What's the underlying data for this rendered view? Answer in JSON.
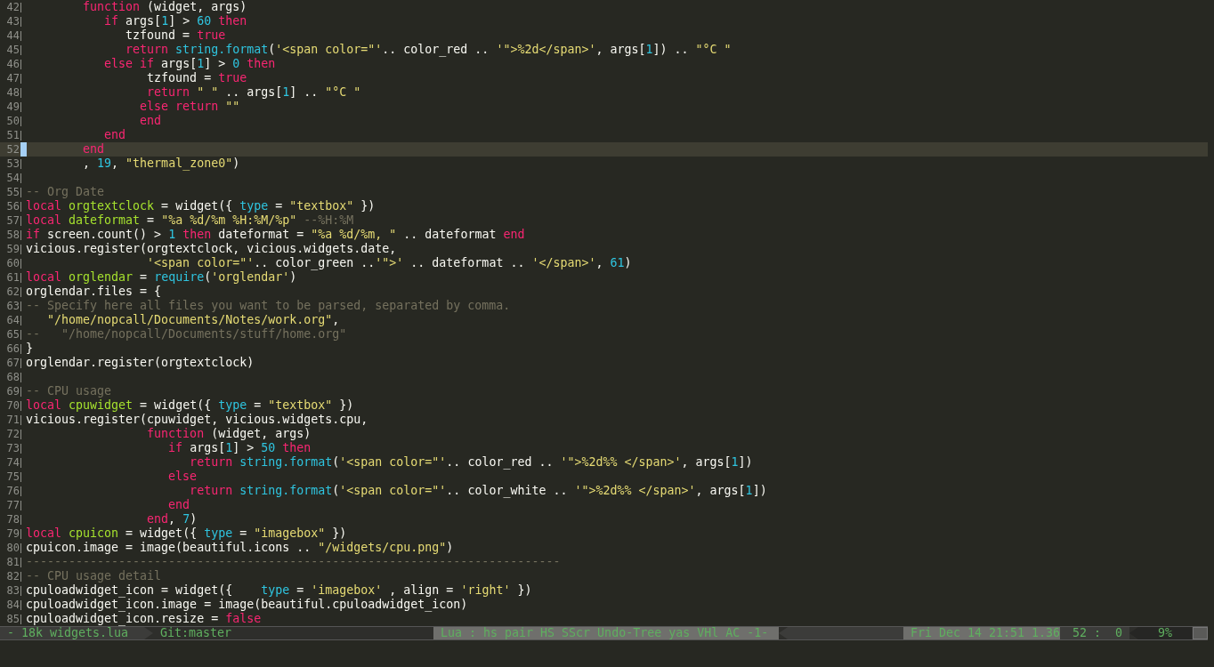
{
  "editor": {
    "lines": [
      {
        "number": "42",
        "current": false,
        "tokens": [
          {
            "kind": "kw",
            "text": "        function"
          },
          {
            "kind": "p",
            "text": " (widget, args)"
          }
        ]
      },
      {
        "number": "43",
        "current": false,
        "tokens": [
          {
            "kind": "kw",
            "text": "           if"
          },
          {
            "kind": "p",
            "text": " args["
          },
          {
            "kind": "num",
            "text": "1"
          },
          {
            "kind": "p",
            "text": "] > "
          },
          {
            "kind": "num",
            "text": "60"
          },
          {
            "kind": "kw",
            "text": " then"
          }
        ]
      },
      {
        "number": "44",
        "current": false,
        "tokens": [
          {
            "kind": "p",
            "text": "              tzfound = "
          },
          {
            "kind": "kw",
            "text": "true"
          }
        ]
      },
      {
        "number": "45",
        "current": false,
        "tokens": [
          {
            "kind": "kw",
            "text": "              return"
          },
          {
            "kind": "bi",
            "text": " string.format"
          },
          {
            "kind": "p",
            "text": "("
          },
          {
            "kind": "str",
            "text": "'<span color=\"'"
          },
          {
            "kind": "p",
            "text": ".. color_red .. "
          },
          {
            "kind": "str",
            "text": "'\">%2d</span>'"
          },
          {
            "kind": "p",
            "text": ", args["
          },
          {
            "kind": "num",
            "text": "1"
          },
          {
            "kind": "p",
            "text": "]) .. "
          },
          {
            "kind": "str",
            "text": "\"°C \""
          }
        ]
      },
      {
        "number": "46",
        "current": false,
        "tokens": [
          {
            "kind": "kw",
            "text": "           else if"
          },
          {
            "kind": "p",
            "text": " args["
          },
          {
            "kind": "num",
            "text": "1"
          },
          {
            "kind": "p",
            "text": "] > "
          },
          {
            "kind": "num",
            "text": "0"
          },
          {
            "kind": "kw",
            "text": " then"
          }
        ]
      },
      {
        "number": "47",
        "current": false,
        "tokens": [
          {
            "kind": "p",
            "text": "                 tzfound = "
          },
          {
            "kind": "kw",
            "text": "true"
          }
        ]
      },
      {
        "number": "48",
        "current": false,
        "tokens": [
          {
            "kind": "kw",
            "text": "                 return"
          },
          {
            "kind": "str",
            "text": " \" \""
          },
          {
            "kind": "p",
            "text": " .. args["
          },
          {
            "kind": "num",
            "text": "1"
          },
          {
            "kind": "p",
            "text": "] .. "
          },
          {
            "kind": "str",
            "text": "\"°C \""
          }
        ]
      },
      {
        "number": "49",
        "current": false,
        "tokens": [
          {
            "kind": "kw",
            "text": "                else return"
          },
          {
            "kind": "str",
            "text": " \"\""
          }
        ]
      },
      {
        "number": "50",
        "current": false,
        "tokens": [
          {
            "kind": "kw",
            "text": "                end"
          }
        ]
      },
      {
        "number": "51",
        "current": false,
        "tokens": [
          {
            "kind": "kw",
            "text": "           end"
          }
        ]
      },
      {
        "number": "52",
        "current": true,
        "tokens": [
          {
            "kind": "kw",
            "text": "        end"
          }
        ]
      },
      {
        "number": "53",
        "current": false,
        "tokens": [
          {
            "kind": "p",
            "text": "        , "
          },
          {
            "kind": "num",
            "text": "19"
          },
          {
            "kind": "p",
            "text": ", "
          },
          {
            "kind": "str",
            "text": "\"thermal_zone0\""
          },
          {
            "kind": "p",
            "text": ")"
          }
        ]
      },
      {
        "number": "54",
        "current": false
      },
      {
        "number": "55",
        "current": false,
        "tokens": [
          {
            "kind": "com",
            "text": "-- Org Date"
          }
        ]
      },
      {
        "number": "56",
        "current": false,
        "tokens": [
          {
            "kind": "kw",
            "text": "local"
          },
          {
            "kind": "var",
            "text": " orgtextclock"
          },
          {
            "kind": "p",
            "text": " = widget({ "
          },
          {
            "kind": "bi",
            "text": "type"
          },
          {
            "kind": "p",
            "text": " = "
          },
          {
            "kind": "str",
            "text": "\"textbox\""
          },
          {
            "kind": "p",
            "text": " })"
          }
        ]
      },
      {
        "number": "57",
        "current": false,
        "tokens": [
          {
            "kind": "kw",
            "text": "local"
          },
          {
            "kind": "var",
            "text": " dateformat"
          },
          {
            "kind": "p",
            "text": " = "
          },
          {
            "kind": "str",
            "text": "\"%a %d/%m %H:%M/%p\""
          },
          {
            "kind": "com",
            "text": " --%H:%M"
          }
        ]
      },
      {
        "number": "58",
        "current": false,
        "tokens": [
          {
            "kind": "kw",
            "text": "if"
          },
          {
            "kind": "p",
            "text": " screen.count() > "
          },
          {
            "kind": "num",
            "text": "1"
          },
          {
            "kind": "kw",
            "text": " then"
          },
          {
            "kind": "p",
            "text": " dateformat = "
          },
          {
            "kind": "str",
            "text": "\"%a %d/%m, \""
          },
          {
            "kind": "p",
            "text": " .. dateformat "
          },
          {
            "kind": "kw",
            "text": "end"
          }
        ]
      },
      {
        "number": "59",
        "current": false,
        "tokens": [
          {
            "kind": "p",
            "text": "vicious.register(orgtextclock, vicious.widgets.date,"
          }
        ]
      },
      {
        "number": "60",
        "current": false,
        "tokens": [
          {
            "kind": "str",
            "text": "                 '<span color=\"'"
          },
          {
            "kind": "p",
            "text": ".. color_green .."
          },
          {
            "kind": "str",
            "text": "'\">'"
          },
          {
            "kind": "p",
            "text": " .. dateformat .. "
          },
          {
            "kind": "str",
            "text": "'</span>'"
          },
          {
            "kind": "p",
            "text": ", "
          },
          {
            "kind": "num",
            "text": "61"
          },
          {
            "kind": "p",
            "text": ")"
          }
        ]
      },
      {
        "number": "61",
        "current": false,
        "tokens": [
          {
            "kind": "kw",
            "text": "local"
          },
          {
            "kind": "var",
            "text": " orglendar"
          },
          {
            "kind": "p",
            "text": " = "
          },
          {
            "kind": "bi",
            "text": "require"
          },
          {
            "kind": "p",
            "text": "("
          },
          {
            "kind": "str",
            "text": "'orglendar'"
          },
          {
            "kind": "p",
            "text": ")"
          }
        ]
      },
      {
        "number": "62",
        "current": false,
        "tokens": [
          {
            "kind": "p",
            "text": "orglendar.files = {"
          }
        ]
      },
      {
        "number": "63",
        "current": false,
        "tokens": [
          {
            "kind": "com",
            "text": "-- Specify here all files you want to be parsed, separated by comma."
          }
        ]
      },
      {
        "number": "64",
        "current": false,
        "tokens": [
          {
            "kind": "str",
            "text": "   \"/home/nopcall/Documents/Notes/work.org\""
          },
          {
            "kind": "p",
            "text": ","
          }
        ]
      },
      {
        "number": "65",
        "current": false,
        "tokens": [
          {
            "kind": "com",
            "text": "--   \"/home/nopcall/Documents/stuff/home.org\""
          }
        ]
      },
      {
        "number": "66",
        "current": false,
        "tokens": [
          {
            "kind": "p",
            "text": "}"
          }
        ]
      },
      {
        "number": "67",
        "current": false,
        "tokens": [
          {
            "kind": "p",
            "text": "orglendar.register(orgtextclock)"
          }
        ]
      },
      {
        "number": "68",
        "current": false
      },
      {
        "number": "69",
        "current": false,
        "tokens": [
          {
            "kind": "com",
            "text": "-- CPU usage"
          }
        ]
      },
      {
        "number": "70",
        "current": false,
        "tokens": [
          {
            "kind": "kw",
            "text": "local"
          },
          {
            "kind": "var",
            "text": " cpuwidget"
          },
          {
            "kind": "p",
            "text": " = widget({ "
          },
          {
            "kind": "bi",
            "text": "type"
          },
          {
            "kind": "p",
            "text": " = "
          },
          {
            "kind": "str",
            "text": "\"textbox\""
          },
          {
            "kind": "p",
            "text": " })"
          }
        ]
      },
      {
        "number": "71",
        "current": false,
        "tokens": [
          {
            "kind": "p",
            "text": "vicious.register(cpuwidget, vicious.widgets.cpu,"
          }
        ]
      },
      {
        "number": "72",
        "current": false,
        "tokens": [
          {
            "kind": "kw",
            "text": "                 function"
          },
          {
            "kind": "p",
            "text": " (widget, args)"
          }
        ]
      },
      {
        "number": "73",
        "current": false,
        "tokens": [
          {
            "kind": "kw",
            "text": "                    if"
          },
          {
            "kind": "p",
            "text": " args["
          },
          {
            "kind": "num",
            "text": "1"
          },
          {
            "kind": "p",
            "text": "] > "
          },
          {
            "kind": "num",
            "text": "50"
          },
          {
            "kind": "kw",
            "text": " then"
          }
        ]
      },
      {
        "number": "74",
        "current": false,
        "tokens": [
          {
            "kind": "kw",
            "text": "                       return"
          },
          {
            "kind": "bi",
            "text": " string.format"
          },
          {
            "kind": "p",
            "text": "("
          },
          {
            "kind": "str",
            "text": "'<span color=\"'"
          },
          {
            "kind": "p",
            "text": ".. color_red .. "
          },
          {
            "kind": "str",
            "text": "'\">%2d%% </span>'"
          },
          {
            "kind": "p",
            "text": ", args["
          },
          {
            "kind": "num",
            "text": "1"
          },
          {
            "kind": "p",
            "text": "])"
          }
        ]
      },
      {
        "number": "75",
        "current": false,
        "tokens": [
          {
            "kind": "kw",
            "text": "                    else"
          }
        ]
      },
      {
        "number": "76",
        "current": false,
        "tokens": [
          {
            "kind": "kw",
            "text": "                       return"
          },
          {
            "kind": "bi",
            "text": " string.format"
          },
          {
            "kind": "p",
            "text": "("
          },
          {
            "kind": "str",
            "text": "'<span color=\"'"
          },
          {
            "kind": "p",
            "text": ".. color_white .. "
          },
          {
            "kind": "str",
            "text": "'\">%2d%% </span>'"
          },
          {
            "kind": "p",
            "text": ", args["
          },
          {
            "kind": "num",
            "text": "1"
          },
          {
            "kind": "p",
            "text": "])"
          }
        ]
      },
      {
        "number": "77",
        "current": false,
        "tokens": [
          {
            "kind": "kw",
            "text": "                    end"
          }
        ]
      },
      {
        "number": "78",
        "current": false,
        "tokens": [
          {
            "kind": "kw",
            "text": "                 end"
          },
          {
            "kind": "p",
            "text": ", "
          },
          {
            "kind": "num",
            "text": "7"
          },
          {
            "kind": "p",
            "text": ")"
          }
        ]
      },
      {
        "number": "79",
        "current": false,
        "tokens": [
          {
            "kind": "kw",
            "text": "local"
          },
          {
            "kind": "var",
            "text": " cpuicon"
          },
          {
            "kind": "p",
            "text": " = widget({ "
          },
          {
            "kind": "bi",
            "text": "type"
          },
          {
            "kind": "p",
            "text": " = "
          },
          {
            "kind": "str",
            "text": "\"imagebox\""
          },
          {
            "kind": "p",
            "text": " })"
          }
        ]
      },
      {
        "number": "80",
        "current": false,
        "tokens": [
          {
            "kind": "p",
            "text": "cpuicon.image = image(beautiful.icons .. "
          },
          {
            "kind": "str",
            "text": "\"/widgets/cpu.png\""
          },
          {
            "kind": "p",
            "text": ")"
          }
        ]
      },
      {
        "number": "81",
        "current": false,
        "tokens": [
          {
            "kind": "com",
            "text": "---------------------------------------------------------------------------"
          }
        ]
      },
      {
        "number": "82",
        "current": false,
        "tokens": [
          {
            "kind": "com",
            "text": "-- CPU usage detail"
          }
        ]
      },
      {
        "number": "83",
        "current": false,
        "tokens": [
          {
            "kind": "p",
            "text": "cpuloadwidget_icon = widget({    "
          },
          {
            "kind": "bi",
            "text": "type"
          },
          {
            "kind": "p",
            "text": " = "
          },
          {
            "kind": "str",
            "text": "'imagebox'"
          },
          {
            "kind": "p",
            "text": " , align = "
          },
          {
            "kind": "str",
            "text": "'right'"
          },
          {
            "kind": "p",
            "text": " })"
          }
        ]
      },
      {
        "number": "84",
        "current": false,
        "tokens": [
          {
            "kind": "p",
            "text": "cpuloadwidget_icon.image = image(beautiful.cpuloadwidget_icon)"
          }
        ]
      },
      {
        "number": "85",
        "current": false,
        "tokens": [
          {
            "kind": "p",
            "text": "cpuloadwidget_icon.resize = "
          },
          {
            "kind": "kw",
            "text": "false"
          }
        ]
      }
    ]
  },
  "mode_line": {
    "buffer": "- 18k widgets.lua",
    "branch": "Git:master",
    "modes": "Lua : hs pair HS SScr Undo-Tree yas VHl AC -1-",
    "clock": "Fri Dec 14 21:51 1.36",
    "position": "52 :  0",
    "percent": "9%"
  }
}
